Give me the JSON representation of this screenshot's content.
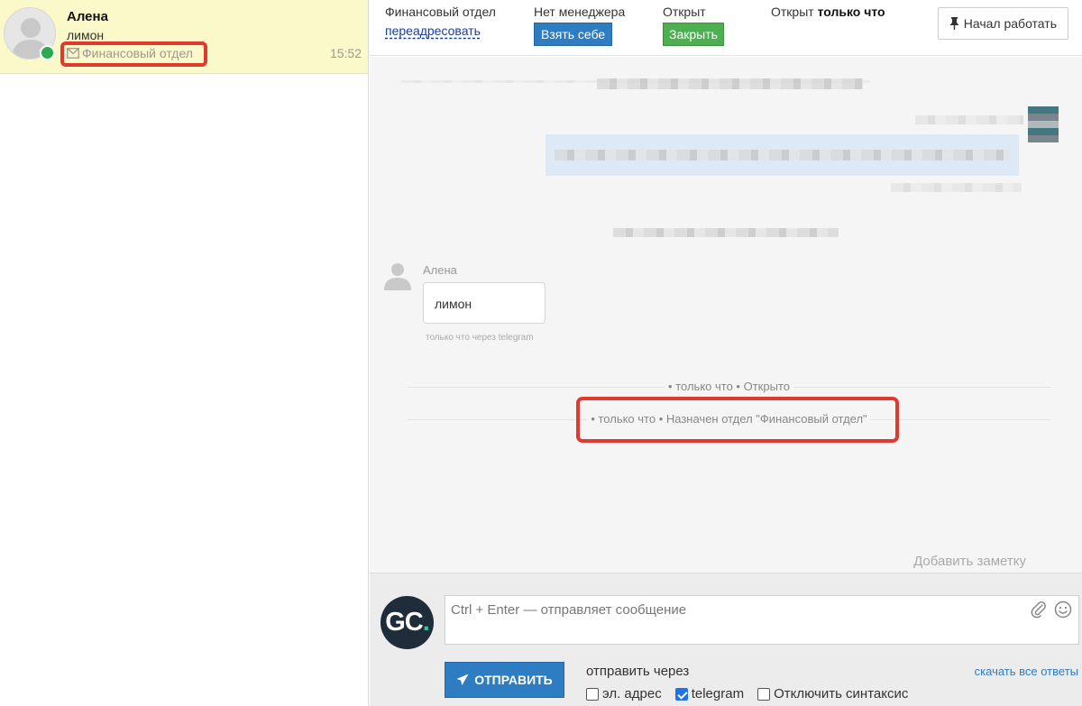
{
  "sidebar": {
    "conversation": {
      "name": "Алена",
      "last_message": "лимон",
      "department": "Финансовый отдел",
      "time": "15:52",
      "online": true
    }
  },
  "topbar": {
    "department_label": "Финансовый отдел",
    "redirect_link": "переадресовать",
    "manager_label": "Нет менеджера",
    "take_button": "Взять себе",
    "status_label": "Открыт",
    "close_button": "Закрыть",
    "opened_prefix": "Открыт",
    "opened_when": "только что",
    "start_button": "Начал работать"
  },
  "chat": {
    "message": {
      "author": "Алена",
      "text": "лимон",
      "meta": "только что через telegram"
    },
    "events": [
      "• только что • Открыто",
      "• только что • Назначен отдел \"Финансовый отдел\""
    ],
    "add_note": "Добавить заметку"
  },
  "composer": {
    "operator_initials": "GC",
    "operator_dot": ".",
    "placeholder": "Ctrl + Enter — отправляет сообщение",
    "send_button": "ОТПРАВИТЬ",
    "send_via_label": "отправить через",
    "download_link": "скачать все ответы",
    "options": [
      {
        "label": "эл. адрес",
        "checked": false
      },
      {
        "label": "telegram",
        "checked": true
      },
      {
        "label": "Отключить синтаксис",
        "checked": false
      }
    ]
  },
  "colors": {
    "selected_row": "#fbf9c9",
    "primary_blue": "#2e7cc2",
    "green": "#4caf50",
    "highlight_red": "#e03a2f",
    "online": "#2daa4f"
  }
}
